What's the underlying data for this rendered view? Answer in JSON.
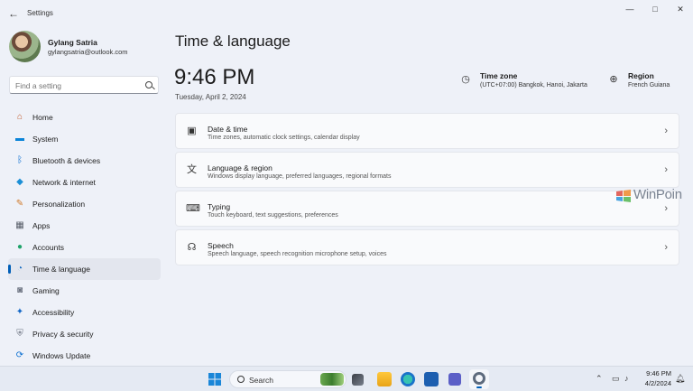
{
  "window": {
    "app_title": "Settings",
    "controls": {
      "minimize": "—",
      "maximize": "□",
      "close": "✕"
    }
  },
  "profile": {
    "name": "Gylang Satria",
    "email": "gylangsatria@outlook.com"
  },
  "search": {
    "placeholder": "Find a setting"
  },
  "sidebar": {
    "items": [
      {
        "label": "Home",
        "icon": "home-icon",
        "glyph": "⌂",
        "color": "#c05a2b"
      },
      {
        "label": "System",
        "icon": "system-icon",
        "glyph": "▬",
        "color": "#0a84d8"
      },
      {
        "label": "Bluetooth & devices",
        "icon": "bluetooth-icon",
        "glyph": "ᛒ",
        "color": "#0a6ed1"
      },
      {
        "label": "Network & internet",
        "icon": "network-icon",
        "glyph": "◆",
        "color": "#1b8fd6"
      },
      {
        "label": "Personalization",
        "icon": "personalization-icon",
        "glyph": "✎",
        "color": "#d07a2b"
      },
      {
        "label": "Apps",
        "icon": "apps-icon",
        "glyph": "▦",
        "color": "#555b66"
      },
      {
        "label": "Accounts",
        "icon": "accounts-icon",
        "glyph": "●",
        "color": "#1fa36a"
      },
      {
        "label": "Time & language",
        "icon": "time-language-icon",
        "glyph": "◔",
        "color": "#1b6fc2",
        "active": true
      },
      {
        "label": "Gaming",
        "icon": "gaming-icon",
        "glyph": "◙",
        "color": "#6b7280"
      },
      {
        "label": "Accessibility",
        "icon": "accessibility-icon",
        "glyph": "✦",
        "color": "#1468c7"
      },
      {
        "label": "Privacy & security",
        "icon": "shield-icon",
        "glyph": "⛨",
        "color": "#6b7280"
      },
      {
        "label": "Windows Update",
        "icon": "windows-update-icon",
        "glyph": "⟳",
        "color": "#0a6ed1"
      }
    ]
  },
  "main": {
    "title": "Time & language",
    "time": "9:46 PM",
    "date": "Tuesday, April 2, 2024",
    "timezone": {
      "title": "Time zone",
      "value": "(UTC+07:00) Bangkok, Hanoi, Jakarta",
      "icon": "timezone-icon",
      "glyph": "◷"
    },
    "region": {
      "title": "Region",
      "value": "French Guiana",
      "icon": "globe-icon",
      "glyph": "⊕"
    },
    "cards": [
      {
        "title": "Date & time",
        "subtitle": "Time zones, automatic clock settings, calendar display",
        "icon": "date-time-icon",
        "glyph": "▣"
      },
      {
        "title": "Language & region",
        "subtitle": "Windows display language, preferred languages, regional formats",
        "icon": "language-icon",
        "glyph": "文"
      },
      {
        "title": "Typing",
        "subtitle": "Touch keyboard, text suggestions, preferences",
        "icon": "keyboard-icon",
        "glyph": "⌨"
      },
      {
        "title": "Speech",
        "subtitle": "Speech language, speech recognition microphone setup, voices",
        "icon": "speech-icon",
        "glyph": "☊"
      }
    ],
    "chevron": "›"
  },
  "watermark": {
    "text": "WinPoin"
  },
  "taskbar": {
    "search_label": "Search",
    "clock_time": "9:46 PM",
    "clock_date": "4/2/2024",
    "accent": "#005fb8"
  }
}
